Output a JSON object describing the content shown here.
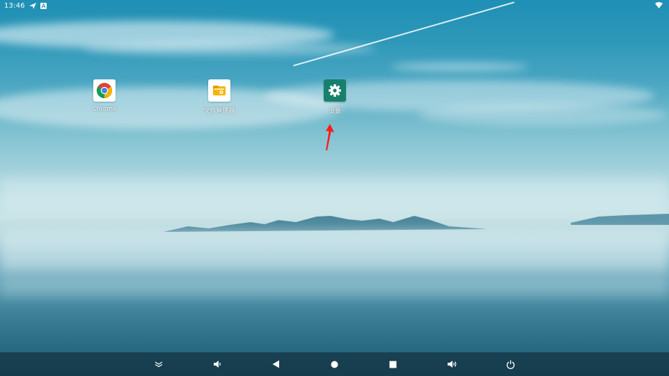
{
  "status_bar": {
    "time": "13:46",
    "icons": [
      "location-arrow-icon",
      "notification-a-icon",
      "wifi-icon"
    ]
  },
  "apps": [
    {
      "label": "Chrome",
      "icon": "chrome-icon"
    },
    {
      "label": "文件管理器",
      "icon": "file-manager-icon"
    },
    {
      "label": "设置",
      "icon": "settings-gear-icon"
    }
  ],
  "annotation": {
    "icon": "red-arrow-icon",
    "color": "#ff1a1a"
  },
  "nav_bar": {
    "buttons": [
      "collapse-icon",
      "volume-down-icon",
      "back-icon",
      "home-icon",
      "recents-icon",
      "volume-up-icon",
      "power-icon"
    ]
  },
  "colors": {
    "settings_icon_bg": "#17806d",
    "file_manager_accent": "#f5b400"
  }
}
